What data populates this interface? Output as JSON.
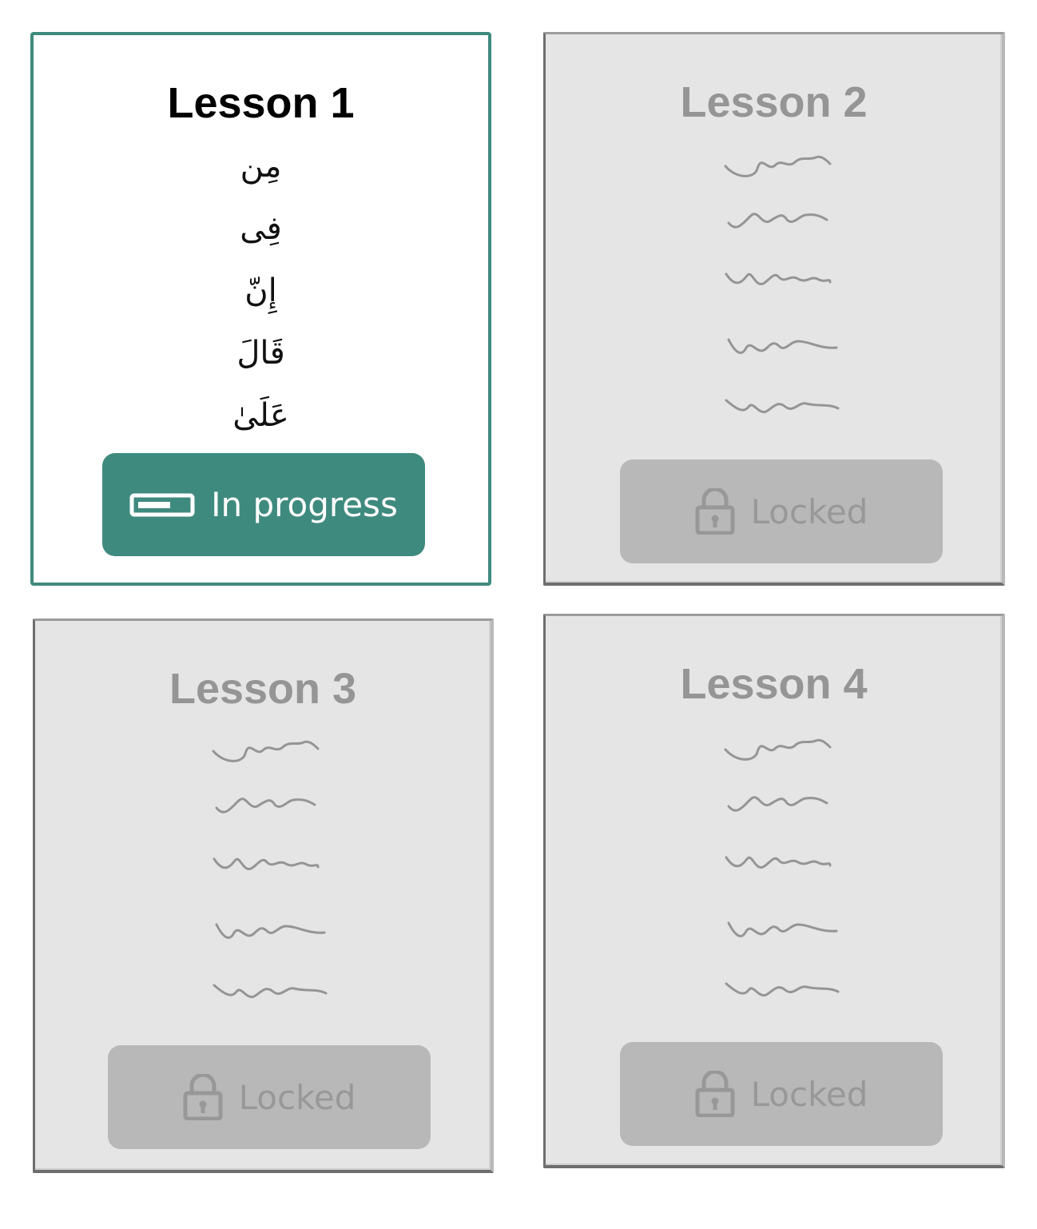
{
  "lessons": [
    {
      "title": "Lesson 1",
      "words": [
        "مِن",
        "فِى",
        "إِنّ",
        "قَالَ",
        "عَلَىٰ"
      ],
      "status": {
        "label": "In progress",
        "icon": "progress-bar-icon"
      }
    },
    {
      "title": "Lesson 2",
      "status": {
        "label": "Locked",
        "icon": "padlock-icon"
      }
    },
    {
      "title": "Lesson 3",
      "status": {
        "label": "Locked",
        "icon": "padlock-icon"
      }
    },
    {
      "title": "Lesson 4",
      "status": {
        "label": "Locked",
        "icon": "padlock-icon"
      }
    }
  ],
  "colors": {
    "accent": "#3f8a7e",
    "locked_card": "#e5e5e5",
    "locked_button": "#b8b8b8",
    "locked_text": "#959595"
  }
}
